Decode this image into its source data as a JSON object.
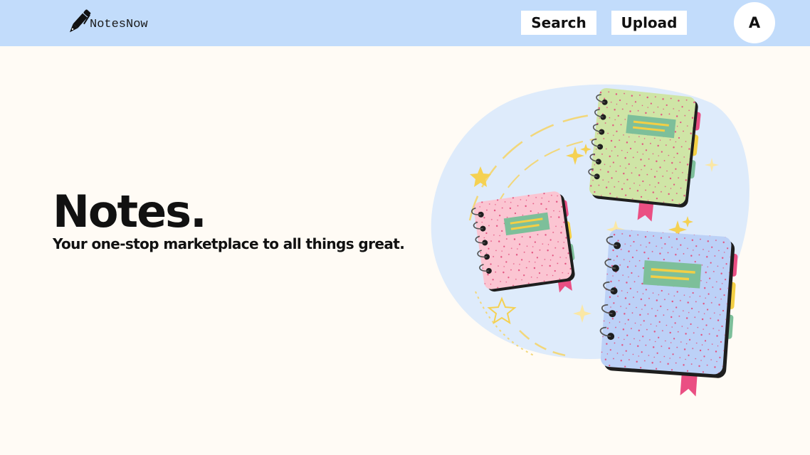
{
  "header": {
    "logo_text": "NotesNow",
    "logo_icon": "pen-icon",
    "search_label": "Search",
    "upload_label": "Upload",
    "avatar_initial": "A"
  },
  "hero": {
    "title": "Notes.",
    "subtitle": "Your one-stop marketplace to all things great.",
    "illustration": "notebooks-illustration"
  },
  "colors": {
    "navbar_bg": "#c2dcfb",
    "page_bg": "#fffbf5",
    "button_bg": "#ffffff",
    "text": "#111111",
    "notebook_green": "#cfe5a6",
    "notebook_pink": "#fbc5d2",
    "notebook_blue": "#bcd1f7",
    "label_green": "#7dbf9a",
    "accent_pink": "#ea4f83",
    "accent_yellow": "#f3d04a",
    "blob_blue": "#deebfb"
  }
}
